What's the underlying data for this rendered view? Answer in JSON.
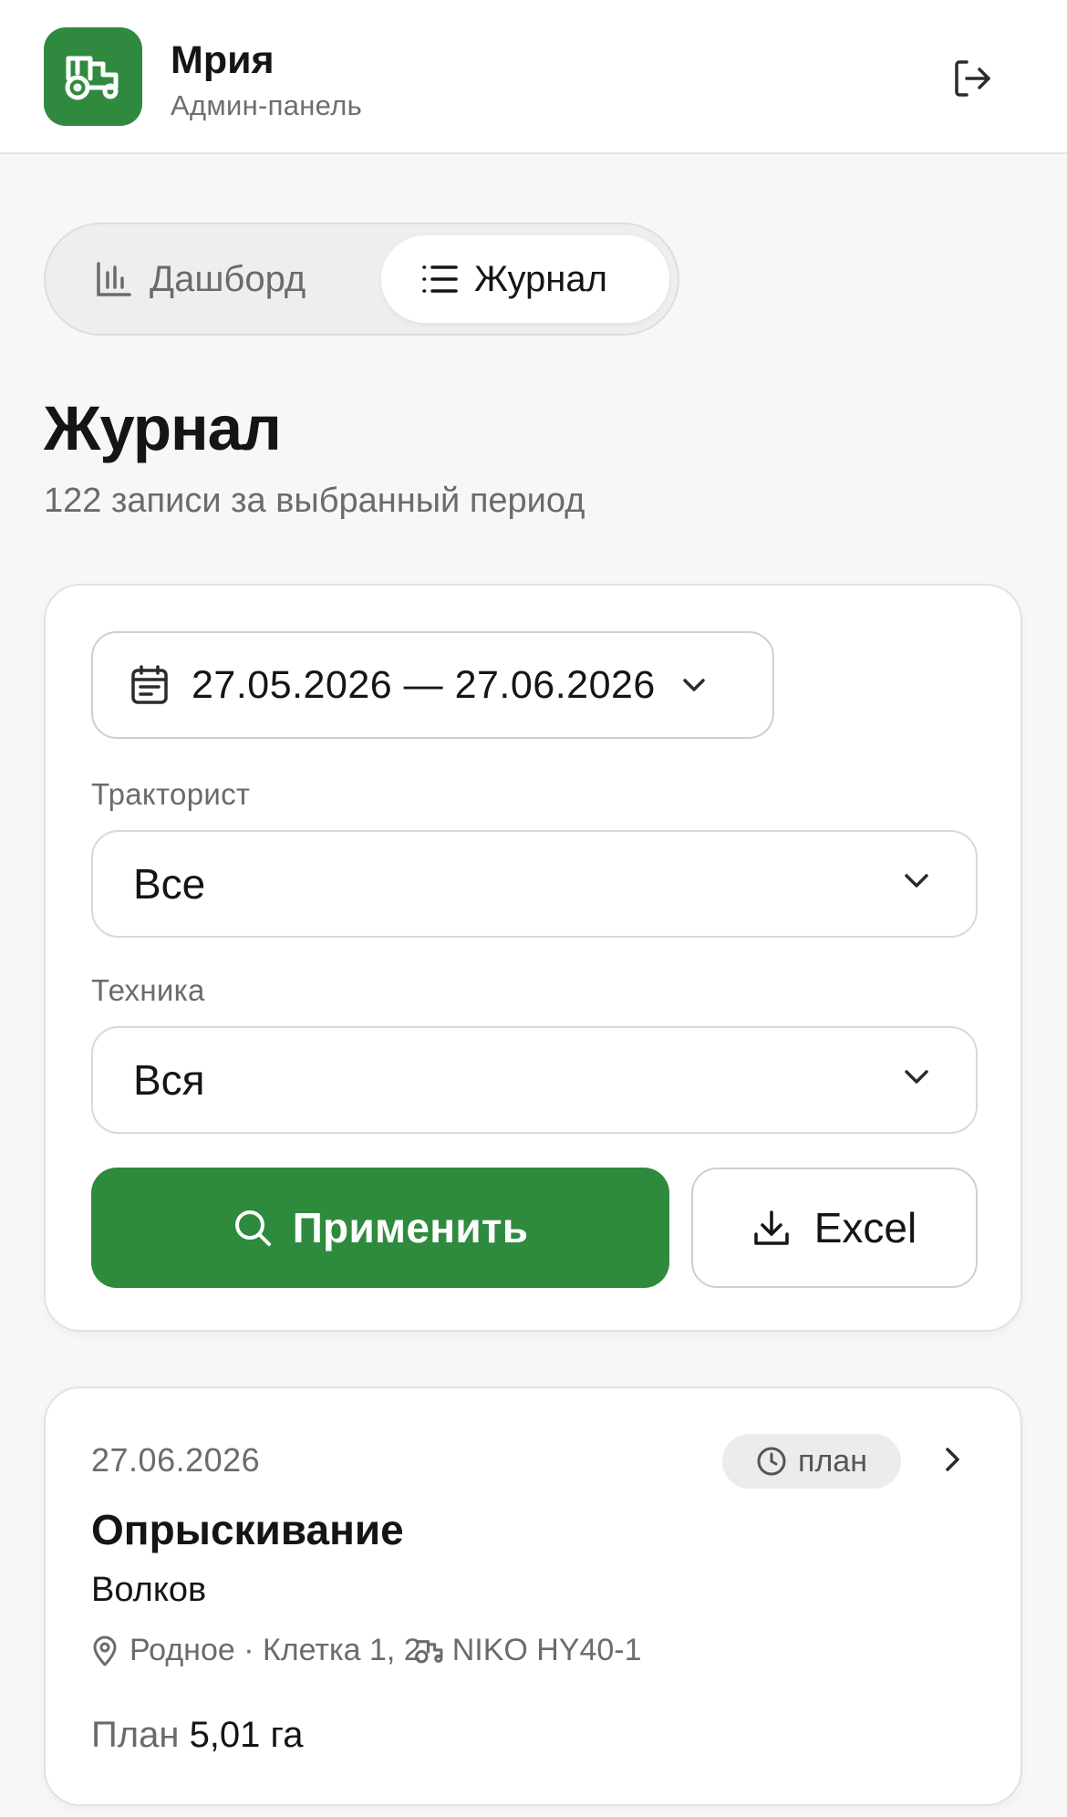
{
  "header": {
    "app_name": "Мрия",
    "subtitle": "Админ-панель",
    "logo_icon": "tractor-icon",
    "logout_icon": "logout-icon",
    "brand_color": "#2f8a3f"
  },
  "tabs": [
    {
      "label": "Дашборд",
      "icon": "bar-chart-icon",
      "active": false
    },
    {
      "label": "Журнал",
      "icon": "list-icon",
      "active": true
    }
  ],
  "page": {
    "title": "Журнал",
    "subtitle": "122 записи за выбранный период"
  },
  "filters": {
    "date_range": "27.05.2026 — 27.06.2026",
    "driver_label": "Тракторист",
    "driver_value": "Все",
    "machine_label": "Техника",
    "machine_value": "Вся",
    "apply_label": "Применить",
    "export_label": "Excel"
  },
  "entries": [
    {
      "date": "27.06.2026",
      "status": "план",
      "operation": "Опрыскивание",
      "driver": "Волков",
      "location": "Родное · Клетка 1, 2",
      "machine": "NIKO HY40-1",
      "plan_label": "План",
      "plan_value": "5,01 га"
    }
  ]
}
